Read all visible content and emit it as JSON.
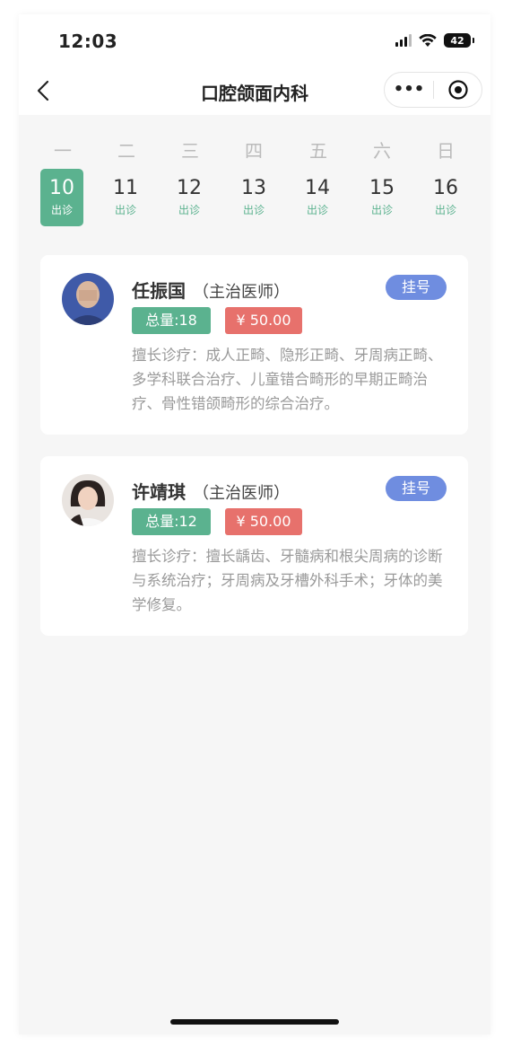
{
  "status_bar": {
    "time": "12:03",
    "battery": "42"
  },
  "nav": {
    "title": "口腔颌面内科",
    "more_icon": "more-dots-icon",
    "target_icon": "target-circle-icon",
    "back_icon": "chevron-left-icon"
  },
  "week": {
    "weekdays": [
      "一",
      "二",
      "三",
      "四",
      "五",
      "六",
      "日"
    ],
    "days": [
      {
        "num": "10",
        "tag": "出诊",
        "active": true
      },
      {
        "num": "11",
        "tag": "出诊"
      },
      {
        "num": "12",
        "tag": "出诊"
      },
      {
        "num": "13",
        "tag": "出诊"
      },
      {
        "num": "14",
        "tag": "出诊"
      },
      {
        "num": "15",
        "tag": "出诊"
      },
      {
        "num": "16",
        "tag": "出诊"
      }
    ]
  },
  "colors": {
    "green": "#5bb28f",
    "red": "#e7716c",
    "blue": "#6f8de0"
  },
  "doctors": [
    {
      "name": "任振国",
      "title": "（主治医师）",
      "register": "挂号",
      "total": "总量:18",
      "price": "¥ 50.00",
      "desc": "擅长诊疗：成人正畸、隐形正畸、牙周病正畸、多学科联合治疗、儿童错合畸形的早期正畸治疗、骨性错颌畸形的综合治疗。"
    },
    {
      "name": "许靖琪",
      "title": "（主治医师）",
      "register": "挂号",
      "total": "总量:12",
      "price": "¥ 50.00",
      "desc": "擅长诊疗：擅长龋齿、牙髓病和根尖周病的诊断与系统治疗；牙周病及牙槽外科手术；牙体的美学修复。"
    }
  ]
}
